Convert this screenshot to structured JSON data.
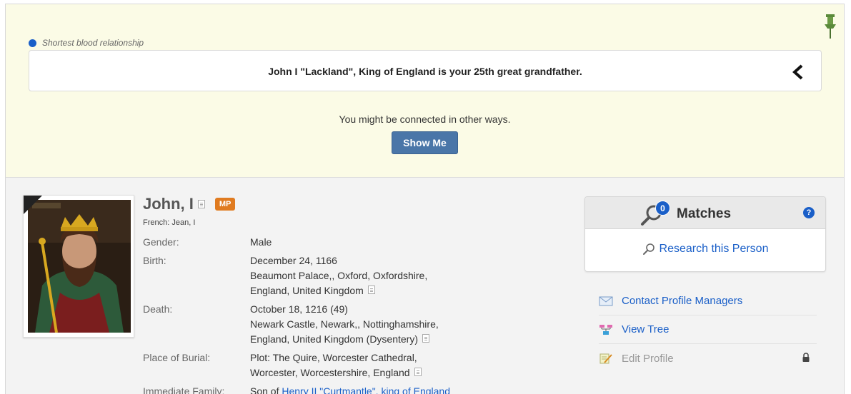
{
  "relationship": {
    "label": "Shortest blood relationship",
    "text": "John I \"Lackland\", King of England is your 25th great grandfather.",
    "connected_text": "You might be connected in other ways.",
    "show_me_label": "Show Me"
  },
  "profile": {
    "name": "John, I",
    "badge": "MP",
    "alt_name": "French: Jean, I",
    "facts": [
      {
        "label": "Gender:",
        "lines": [
          "Male"
        ]
      },
      {
        "label": "Birth:",
        "lines": [
          "December 24, 1166",
          "Beaumont Palace,, Oxford, Oxfordshire,",
          "England, United Kingdom"
        ]
      },
      {
        "label": "Death:",
        "lines": [
          "October 18, 1216 (49)",
          "Newark Castle, Newark,, Nottinghamshire,",
          "England, United Kingdom (Dysentery)"
        ]
      },
      {
        "label": "Place of Burial:",
        "lines": [
          "Plot: The Quire, Worcester Cathedral,",
          "Worcester, Worcestershire, England"
        ]
      },
      {
        "label": "Immediate Family:",
        "prefix": "Son of ",
        "link": "Henry II \"Curtmantle\", king of England"
      }
    ]
  },
  "matches": {
    "count": "0",
    "title": "Matches",
    "help": "?",
    "research_label": "Research this Person"
  },
  "actions": [
    {
      "label": "Contact Profile Managers",
      "icon": "envelope-icon"
    },
    {
      "label": "View Tree",
      "icon": "tree-icon"
    },
    {
      "label": "Edit Profile",
      "icon": "edit-icon",
      "locked": true
    }
  ],
  "colors": {
    "accent": "#1a5fc8",
    "button": "#4a76a8",
    "badge": "#e07b20",
    "panel": "#fbfbe6"
  }
}
